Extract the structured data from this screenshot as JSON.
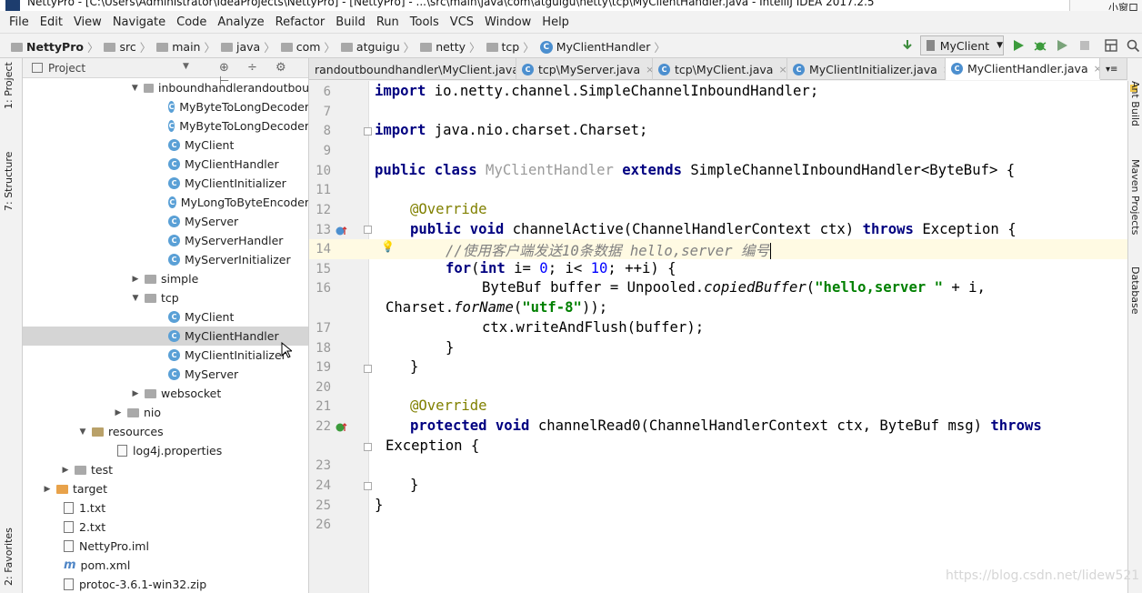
{
  "window": {
    "title": "NettyPro - [C:\\Users\\Administrator\\IdeaProjects\\NettyPro] - [NettyPro] - ...\\src\\main\\java\\com\\atguigu\\netty\\tcp\\MyClientHandler.java - IntelliJ IDEA 2017.2.5",
    "corner_text": "小窗口"
  },
  "menu": [
    "File",
    "Edit",
    "View",
    "Navigate",
    "Code",
    "Analyze",
    "Refactor",
    "Build",
    "Run",
    "Tools",
    "VCS",
    "Window",
    "Help"
  ],
  "breadcrumbs": [
    "NettyPro",
    "src",
    "main",
    "java",
    "com",
    "atguigu",
    "netty",
    "tcp",
    "MyClientHandler"
  ],
  "run_config": "MyClient",
  "left_strip": {
    "project": "1: Project",
    "structure": "7: Structure",
    "favorites": "2: Favorites"
  },
  "right_strip": {
    "ant": "Ant Build",
    "maven": "Maven Projects",
    "database": "Database"
  },
  "project_panel": {
    "title": "Project"
  },
  "tree": [
    {
      "label": "inboundhandlerandoutbou",
      "kind": "folder",
      "expanded": true
    },
    {
      "label": "MyByteToLongDecoder",
      "kind": "class"
    },
    {
      "label": "MyByteToLongDecoder",
      "kind": "class"
    },
    {
      "label": "MyClient",
      "kind": "class"
    },
    {
      "label": "MyClientHandler",
      "kind": "class"
    },
    {
      "label": "MyClientInitializer",
      "kind": "class"
    },
    {
      "label": "MyLongToByteEncoder",
      "kind": "class"
    },
    {
      "label": "MyServer",
      "kind": "class"
    },
    {
      "label": "MyServerHandler",
      "kind": "class"
    },
    {
      "label": "MyServerInitializer",
      "kind": "class"
    },
    {
      "label": "simple",
      "kind": "folder",
      "expanded": false
    },
    {
      "label": "tcp",
      "kind": "folder",
      "expanded": true
    },
    {
      "label": "MyClient",
      "kind": "class"
    },
    {
      "label": "MyClientHandler",
      "kind": "class",
      "selected": true
    },
    {
      "label": "MyClientInitializer",
      "kind": "class"
    },
    {
      "label": "MyServer",
      "kind": "class"
    },
    {
      "label": "websocket",
      "kind": "folder",
      "expanded": false
    },
    {
      "label": "nio",
      "kind": "folder",
      "expanded": false
    },
    {
      "label": "resources",
      "kind": "res",
      "expanded": true
    },
    {
      "label": "log4j.properties",
      "kind": "file"
    },
    {
      "label": "test",
      "kind": "folder",
      "expanded": false
    },
    {
      "label": "target",
      "kind": "orange",
      "expanded": false
    },
    {
      "label": "1.txt",
      "kind": "file"
    },
    {
      "label": "2.txt",
      "kind": "file"
    },
    {
      "label": "NettyPro.iml",
      "kind": "file"
    },
    {
      "label": "pom.xml",
      "kind": "maven"
    },
    {
      "label": "protoc-3.6.1-win32.zip",
      "kind": "file"
    }
  ],
  "tabs": [
    {
      "label": "randoutboundhandler\\MyClient.java"
    },
    {
      "label": "tcp\\MyServer.java"
    },
    {
      "label": "tcp\\MyClient.java"
    },
    {
      "label": "MyClientInitializer.java"
    },
    {
      "label": "MyClientHandler.java",
      "active": true
    }
  ],
  "line_numbers": [
    "6",
    "7",
    "8",
    "9",
    "10",
    "11",
    "12",
    "13",
    "14",
    "15",
    "16",
    "17",
    "18",
    "19",
    "20",
    "21",
    "22",
    "23",
    "24",
    "25",
    "26"
  ],
  "code": {
    "l6_kw": "import",
    "l6_rest": " io.netty.channel.SimpleChannelInboundHandler;",
    "l8_kw": "import",
    "l8_rest": " java.nio.charset.Charset;",
    "l10_kw1": "public class",
    "l10_name": " MyClientHandler",
    "l10_kw2": " extends",
    "l10_rest": " SimpleChannelInboundHandler<ByteBuf> {",
    "l12_an": "@Override",
    "l13_kw1": "public void",
    "l13_mid": " channelActive(ChannelHandlerContext ctx) ",
    "l13_kw2": "throws",
    "l13_rest": " Exception {",
    "l14_cm": "//使用客户端发送10条数据 hello,server 编号",
    "l15_kw1": "for",
    "l15_a": "(",
    "l15_kw2": "int",
    "l15_b": " i= ",
    "l15_n1": "0",
    "l15_c": "; i< ",
    "l15_n2": "10",
    "l15_d": "; ++i) {",
    "l16_a": "ByteBuf buffer = Unpooled.",
    "l16_it": "copiedBuffer",
    "l16_b": "(",
    "l16_st": "\"hello,server \"",
    "l16_c": " + i,",
    "l16w_a": "Charset.",
    "l16w_it": "forName",
    "l16w_b": "(",
    "l16w_st": "\"utf-8\"",
    "l16w_c": "));",
    "l17": "ctx.writeAndFlush(buffer);",
    "l18": "}",
    "l19": "}",
    "l21_an": "@Override",
    "l22_kw1": "protected void",
    "l22_mid": " channelRead0(ChannelHandlerContext ctx, ByteBuf msg) ",
    "l22_kw2": "throws",
    "l22w": "Exception {",
    "l24": "}",
    "l25": "}"
  },
  "watermark": "https://blog.csdn.net/lidew521"
}
